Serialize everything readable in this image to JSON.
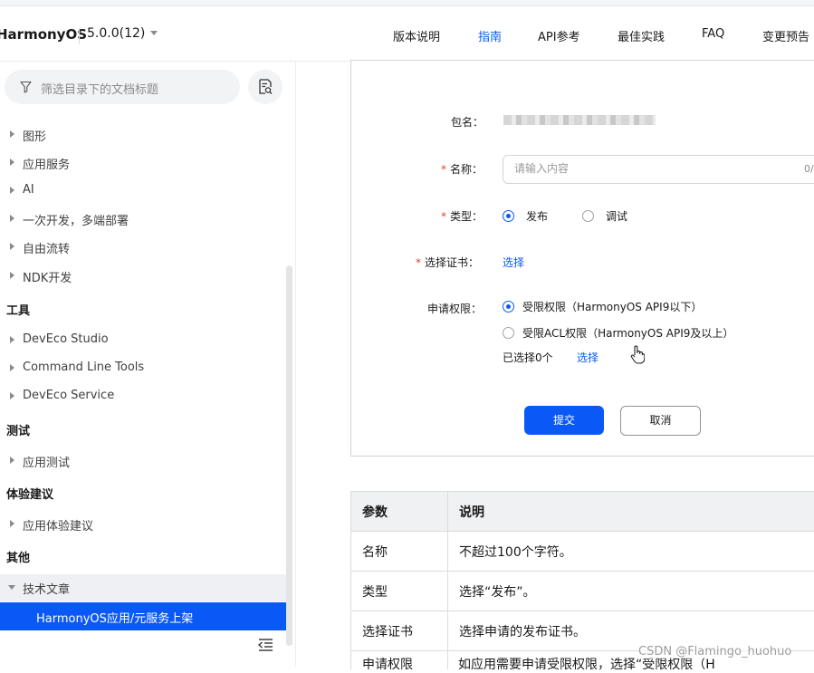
{
  "header": {
    "brand": "HarmonyOS",
    "version": "5.0.0(12)",
    "nav": [
      "版本说明",
      "指南",
      "API参考",
      "最佳实践",
      "FAQ",
      "变更预告"
    ],
    "active_nav": "指南"
  },
  "sidebar": {
    "search_placeholder": "筛选目录下的文档标题",
    "items": [
      {
        "label": "图形"
      },
      {
        "label": "应用服务"
      },
      {
        "label": "AI"
      },
      {
        "label": "一次开发，多端部署"
      },
      {
        "label": "自由流转"
      },
      {
        "label": "NDK开发"
      }
    ],
    "section_tools": "工具",
    "tools_items": [
      {
        "label": "DevEco Studio"
      },
      {
        "label": "Command Line Tools"
      },
      {
        "label": "DevEco Service"
      }
    ],
    "section_test": "测试",
    "test_items": [
      {
        "label": "应用测试"
      }
    ],
    "section_experience": "体验建议",
    "experience_items": [
      {
        "label": "应用体验建议"
      }
    ],
    "section_other": "其他",
    "expanded_item": "技术文章",
    "selected_item": "HarmonyOS应用/元服务上架"
  },
  "form": {
    "package_label": "包名：",
    "name_label": "名称：",
    "name_placeholder": "请输入内容",
    "name_counter": "0/",
    "type_label": "类型：",
    "type_options": [
      "发布",
      "调试"
    ],
    "type_selected": "发布",
    "cert_label": "选择证书：",
    "cert_link": "选择",
    "perm_label": "申请权限：",
    "perm_options": [
      "受限权限（HarmonyOS API9以下）",
      "受限ACL权限（HarmonyOS API9及以上）"
    ],
    "perm_selected": "受限权限（HarmonyOS API9以下）",
    "selected_count": "已选择0个",
    "perm_link": "选择",
    "submit": "提交",
    "cancel": "取消"
  },
  "table": {
    "headers": [
      "参数",
      "说明"
    ],
    "rows": [
      [
        "名称",
        "不超过100个字符。"
      ],
      [
        "类型",
        "选择“发布”。"
      ],
      [
        "选择证书",
        "选择申请的发布证书。"
      ]
    ],
    "partial_row": [
      "申请权限",
      "如应用需要申请受限权限，选择“受限权限（H"
    ]
  },
  "watermark": "CSDN @Flamingo_huohuo",
  "colors": {
    "accent": "#0a59f7",
    "required": "#e84026"
  }
}
